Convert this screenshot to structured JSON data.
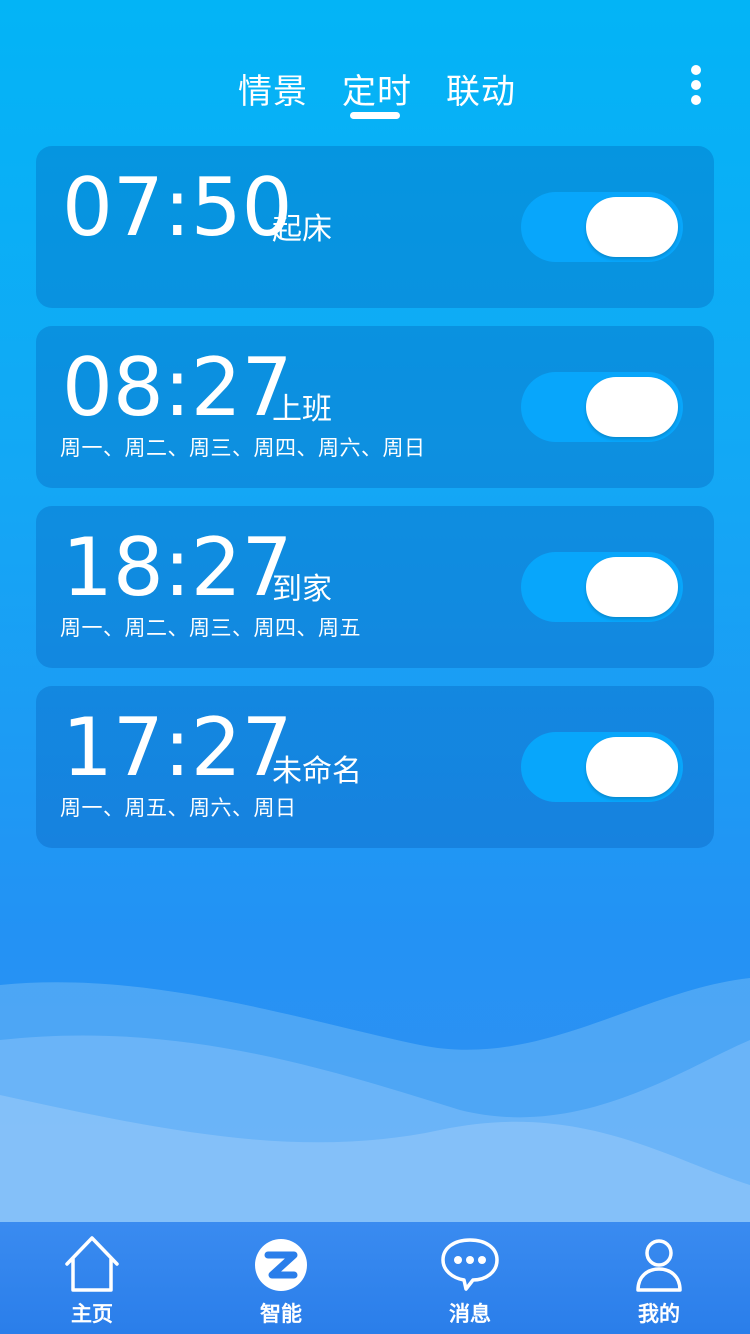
{
  "tabs": [
    {
      "label": "情景"
    },
    {
      "label": "定时",
      "active": true
    },
    {
      "label": "联动"
    }
  ],
  "timers": [
    {
      "time": "07:50",
      "name": "起床",
      "days": "",
      "enabled": true
    },
    {
      "time": "08:27",
      "name": "上班",
      "days": "周一、周二、周三、周四、周六、周日",
      "enabled": true
    },
    {
      "time": "18:27",
      "name": "到家",
      "days": "周一、周二、周三、周四、周五",
      "enabled": true
    },
    {
      "time": "17:27",
      "name": "未命名",
      "days": "周一、周五、周六、周日",
      "enabled": true
    }
  ],
  "bottom_nav": [
    {
      "label": "主页",
      "icon": "home-icon"
    },
    {
      "label": "智能",
      "icon": "smart-z-icon",
      "active": true
    },
    {
      "label": "消息",
      "icon": "message-icon"
    },
    {
      "label": "我的",
      "icon": "user-icon"
    }
  ],
  "colors": {
    "background_top": "#03b4f6",
    "background_bottom": "#3d8ff1",
    "toggle_on": "#08a6fb",
    "text": "#ffffff"
  }
}
